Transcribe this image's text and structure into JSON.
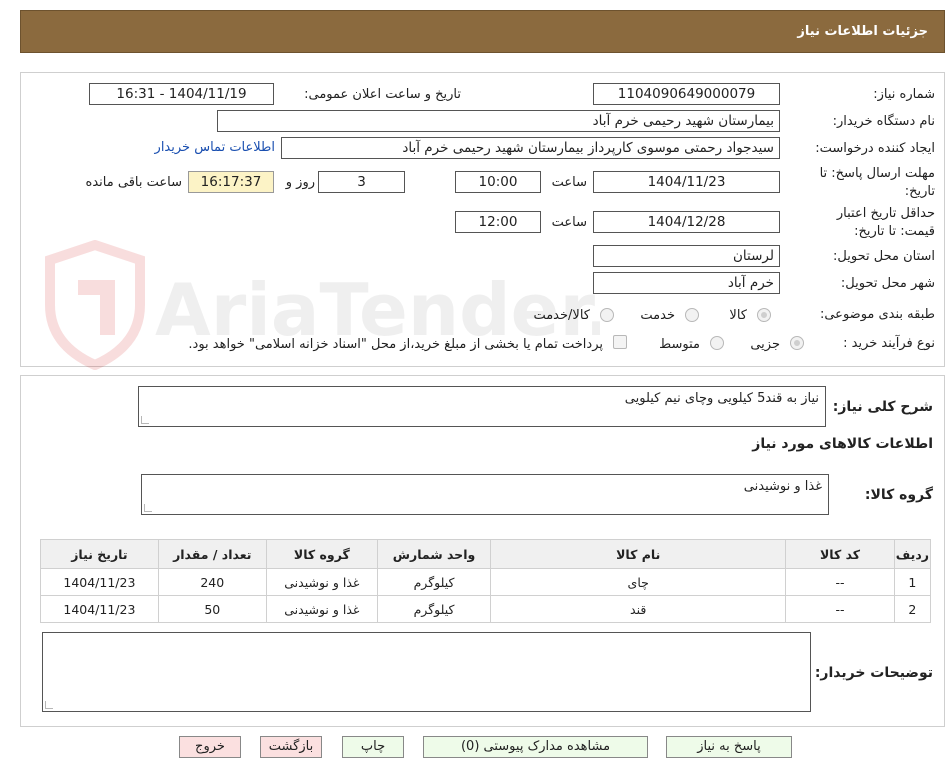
{
  "header": {
    "title": "جزئیات اطلاعات نیاز"
  },
  "form": {
    "need_number": {
      "label": "شماره نیاز:",
      "value": "1104090649000079"
    },
    "announce_datetime": {
      "label": "تاریخ و ساعت اعلان عمومی:",
      "value": "1404/11/19 - 16:31"
    },
    "buyer_org": {
      "label": "نام دستگاه خریدار:",
      "value": "بیمارستان شهید رحیمی خرم آباد"
    },
    "requester": {
      "label": "ایجاد کننده درخواست:",
      "value": "سیدجواد رحمتی موسوی کارپرداز بیمارستان شهید رحیمی خرم آباد"
    },
    "contact_link": "اطلاعات تماس خریدار",
    "deadline": {
      "label1": "مهلت ارسال پاسخ: تا",
      "label2": "تاریخ:",
      "date": "1404/11/23",
      "time_label": "ساعت",
      "time": "10:00",
      "days": "3",
      "days_label": "روز و",
      "remaining": "16:17:37",
      "remaining_label": "ساعت باقی مانده"
    },
    "validity": {
      "label1": "حداقل تاریخ اعتبار",
      "label2": "قیمت: تا تاریخ:",
      "date": "1404/12/28",
      "time_label": "ساعت",
      "time": "12:00"
    },
    "province": {
      "label": "استان محل تحویل:",
      "value": "لرستان"
    },
    "city": {
      "label": "شهر محل تحویل:",
      "value": "خرم آباد"
    },
    "category": {
      "label": "طبقه بندی موضوعی:",
      "options": [
        "کالا",
        "خدمت",
        "کالا/خدمت"
      ],
      "selected": "کالا"
    },
    "purchase_type": {
      "label": "نوع فرآیند خرید :",
      "options": [
        "جزیی",
        "متوسط"
      ],
      "selected": "جزیی",
      "note": "پرداخت تمام یا بخشی از مبلغ خرید،از محل \"اسناد خزانه اسلامی\" خواهد بود."
    }
  },
  "description": {
    "label": "شرح کلی نیاز:",
    "value": "نیاز به قند5 کیلویی وچای نیم کیلویی"
  },
  "goods_info": {
    "title": "اطلاعات کالاهای مورد نیاز",
    "group_label": "گروه کالا:",
    "group_value": "غذا و نوشیدنی"
  },
  "table": {
    "headers": [
      "ردیف",
      "کد کالا",
      "نام کالا",
      "واحد شمارش",
      "گروه کالا",
      "تعداد / مقدار",
      "تاریخ نیاز"
    ],
    "rows": [
      [
        "1",
        "--",
        "چای",
        "کیلوگرم",
        "غذا و نوشیدنی",
        "240",
        "1404/11/23"
      ],
      [
        "2",
        "--",
        "قند",
        "کیلوگرم",
        "غذا و نوشیدنی",
        "50",
        "1404/11/23"
      ]
    ]
  },
  "buyer_notes": {
    "label": "توضیحات خریدار:",
    "value": ""
  },
  "buttons": {
    "reply": "پاسخ به نیاز",
    "attachments": "مشاهده مدارک پیوستی (0)",
    "print": "چاپ",
    "back": "بازگشت",
    "exit": "خروج"
  },
  "watermark_text": "AriaTender.neT",
  "colors": {
    "header": "#8b6a3e",
    "button": "#eefbe9",
    "button_pink": "#fbe0e0",
    "remaining_bg": "#fcf3c6",
    "link": "#1a4fb0"
  }
}
